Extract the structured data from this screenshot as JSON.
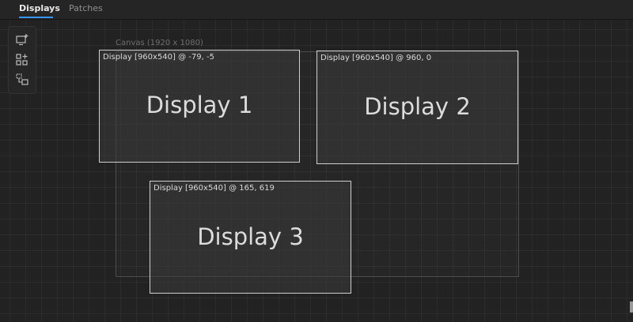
{
  "tabs": [
    {
      "label": "Displays",
      "active": true
    },
    {
      "label": "Patches",
      "active": false
    }
  ],
  "toolbox": {
    "tools": [
      {
        "icon": "add-display-icon"
      },
      {
        "icon": "add-grid-icon"
      },
      {
        "icon": "patch-link-icon"
      }
    ]
  },
  "canvas": {
    "label": "Canvas (1920 x 1080)"
  },
  "displays": [
    {
      "name": "Display 1",
      "info": "Display [960x540] @ -79, -5"
    },
    {
      "name": "Display 2",
      "info": "Display [960x540] @ 960, 0"
    },
    {
      "name": "Display 3",
      "info": "Display [960x540] @ 165, 619"
    }
  ],
  "colors": {
    "accent": "#3794ff",
    "background": "#1e1e1e",
    "display_border": "#cfcfcf"
  }
}
